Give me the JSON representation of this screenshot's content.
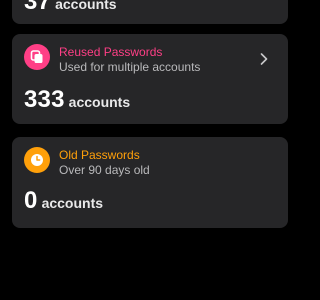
{
  "colors": {
    "background": "#000000",
    "card": "#262628",
    "reused_accent": "#ff3f86",
    "old_accent": "#ffa00a",
    "text_primary": "#ffffff",
    "text_secondary": "#b9b9bb"
  },
  "top_card": {
    "count": "37",
    "unit": "accounts"
  },
  "reused_card": {
    "icon": "copy-icon",
    "title": "Reused Passwords",
    "subtitle": "Used for multiple accounts",
    "count": "333",
    "unit": "accounts",
    "action_icon": "chevron-right-icon"
  },
  "old_card": {
    "icon": "clock-icon",
    "title": "Old Passwords",
    "subtitle": "Over 90 days old",
    "count": "0",
    "unit": "accounts"
  }
}
